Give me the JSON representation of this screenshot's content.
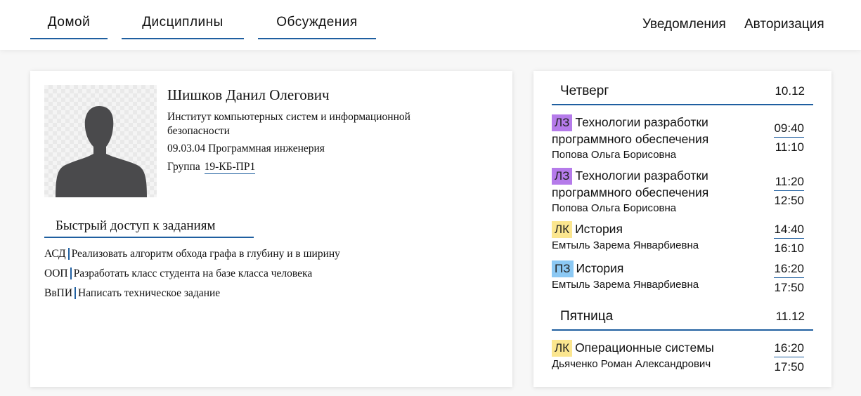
{
  "nav": {
    "home": "Домой",
    "disciplines": "Дисциплины",
    "discussions": "Обсуждения",
    "notifications": "Уведомления",
    "login": "Авторизация"
  },
  "profile": {
    "name": "Шишков Данил Олегович",
    "institute": "Институт компьютерных систем и информационной безопасности",
    "specialty": "09.03.04 Программная инженерия",
    "group_label": "Группа",
    "group": "19-КБ-ПР1"
  },
  "quick_access": {
    "title": "Быстрый доступ к заданиям",
    "tasks": [
      {
        "code": "АСД",
        "text": "Реализовать алгоритм обхода графа в глубину и в ширину"
      },
      {
        "code": "ООП",
        "text": "Разработать класс студента на базе класса человека"
      },
      {
        "code": "ВвПИ",
        "text": "Написать техническое задание"
      }
    ]
  },
  "schedule": {
    "days": [
      {
        "name": "Четверг",
        "date": "10.12",
        "lessons": [
          {
            "type": "ЛЗ",
            "subject": "Технологии разработки программного обеспечения",
            "teacher": "Попова Ольга Борисовна",
            "start": "09:40",
            "end": "11:10"
          },
          {
            "type": "ЛЗ",
            "subject": "Технологии разработки программного обеспечения",
            "teacher": "Попова Ольга Борисовна",
            "start": "11:20",
            "end": "12:50"
          },
          {
            "type": "ЛК",
            "subject": "История",
            "teacher": "Емтыль Зарема Январбиевна",
            "start": "14:40",
            "end": "16:10"
          },
          {
            "type": "ПЗ",
            "subject": "История",
            "teacher": "Емтыль Зарема Январбиевна",
            "start": "16:20",
            "end": "17:50"
          }
        ]
      },
      {
        "name": "Пятница",
        "date": "11.12",
        "lessons": [
          {
            "type": "ЛК",
            "subject": "Операционные системы",
            "teacher": "Дьяченко Роман Александрович",
            "start": "16:20",
            "end": "17:50"
          }
        ]
      }
    ]
  },
  "colors": {
    "accent": "#1f5fa0",
    "badge_lz": "#b57bea",
    "badge_lk": "#fbe68f",
    "badge_pz": "#8cc9f4",
    "avatar_silhouette": "#4a4a4c"
  },
  "icons": {
    "avatar": "user-silhouette-icon"
  }
}
